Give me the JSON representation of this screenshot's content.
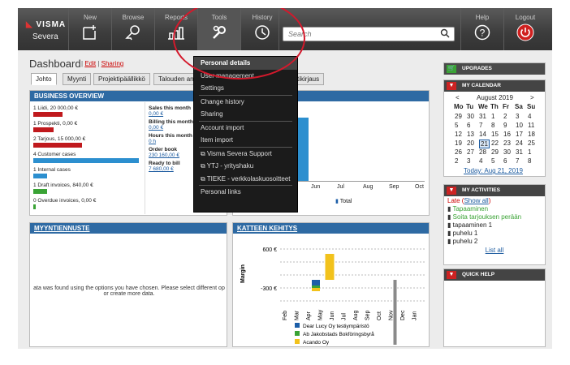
{
  "brand": {
    "logo": "VISMA",
    "product": "Severa"
  },
  "nav": [
    {
      "id": "new",
      "label": "New"
    },
    {
      "id": "browse",
      "label": "Browse"
    },
    {
      "id": "reports",
      "label": "Reports"
    },
    {
      "id": "tools",
      "label": "Tools"
    },
    {
      "id": "history",
      "label": "History"
    },
    {
      "id": "help",
      "label": "Help"
    },
    {
      "id": "logout",
      "label": "Logout"
    }
  ],
  "search": {
    "placeholder": "Search"
  },
  "dashboard": {
    "title": "Dashboard",
    "edit": "Edit",
    "sharing": "Sharing"
  },
  "tabs": [
    "Johto",
    "Myynti",
    "Projektipäällikkö",
    "Talouden an",
    "tikirjaus"
  ],
  "business_overview": {
    "title": "BUSINESS OVERVIEW",
    "rows": [
      {
        "label": "1 Liidi, 20 000,00 €",
        "color": "#c0191d",
        "fill": 0.27
      },
      {
        "label": "1 Prospekti, 0,00 €",
        "color": "#c0191d",
        "fill": 0.19
      },
      {
        "label": "2 Tarjous, 15 000,00 €",
        "color": "#c0191d",
        "fill": 0.45
      },
      {
        "label": "4 Customer cases",
        "color": "#2c8fcf",
        "fill": 0.97
      },
      {
        "label": "1 Internal cases",
        "color": "#2c8fcf",
        "fill": 0.13
      },
      {
        "label": "1 Draft invoices, 840,00 €",
        "color": "#3aa335",
        "fill": 0.13
      },
      {
        "label": "0 Overdue invoices, 0,00 €",
        "color": "#3aa335",
        "fill": 0.02
      }
    ],
    "stats": [
      {
        "label": "Sales this month",
        "value": "0,00 €"
      },
      {
        "label": "Billing this month",
        "value": "0,00 €"
      },
      {
        "label": "Hours this month",
        "value": "0 h"
      },
      {
        "label": "Order book",
        "value": "230 160,00 €"
      },
      {
        "label": "Ready to bill",
        "value": "7 680,00 €"
      }
    ]
  },
  "billing_chart": {
    "months": [
      "Jun",
      "Jul",
      "Aug",
      "Sep",
      "Oct"
    ],
    "legend": "Total"
  },
  "myyntiennuste": {
    "title": "MYYNTIENNUSTE",
    "message1": "ata was found using the options you have chosen. Please select different op",
    "message2": "or create more data."
  },
  "kate": {
    "title": "KATTEEN KEHITYS",
    "ylabel": "Margin",
    "yticks": [
      "600 €",
      "-300 €"
    ],
    "months": [
      "Feb",
      "Mar",
      "Apr",
      "May",
      "Jun",
      "Jul",
      "Aug",
      "Sep",
      "Oct",
      "Nov",
      "Dec",
      "Jan"
    ],
    "legend": [
      "Dear Lucy Oy testiympäristö",
      "Ab Jakobstads Bokföringsbyrå",
      "Acando Oy"
    ],
    "colors": [
      "#1c5ea8",
      "#3aa335",
      "#f2c21c",
      "#8a8a8a"
    ]
  },
  "tools_menu": [
    {
      "label": "Personal details",
      "highlight": true
    },
    {
      "label": "User management"
    },
    {
      "label": "Settings"
    },
    {
      "sep": true
    },
    {
      "label": "Change history"
    },
    {
      "label": "Sharing"
    },
    {
      "sep": true
    },
    {
      "label": "Account import"
    },
    {
      "label": "Item import"
    },
    {
      "sep": true
    },
    {
      "label": "Visma Severa Support",
      "ext": true
    },
    {
      "label": "YTJ - yrityshaku",
      "ext": true
    },
    {
      "label": "TIEKE - verkkolaskuosoitteet",
      "ext": true
    },
    {
      "sep": true
    },
    {
      "label": "Personal links"
    }
  ],
  "upgrades": {
    "title": "UPGRADES"
  },
  "calendar": {
    "title": "MY CALENDAR",
    "month": "August 2019",
    "prev": "<",
    "next": ">",
    "weekdays": [
      "Mo",
      "Tu",
      "We",
      "Th",
      "Fr",
      "Sa",
      "Su"
    ],
    "weeks": [
      [
        "29",
        "30",
        "31",
        "1",
        "2",
        "3",
        "4"
      ],
      [
        "5",
        "6",
        "7",
        "8",
        "9",
        "10",
        "11"
      ],
      [
        "12",
        "13",
        "14",
        "15",
        "16",
        "17",
        "18"
      ],
      [
        "19",
        "20",
        "21",
        "22",
        "23",
        "24",
        "25"
      ],
      [
        "26",
        "27",
        "28",
        "29",
        "30",
        "31",
        "1"
      ],
      [
        "2",
        "3",
        "4",
        "5",
        "6",
        "7",
        "8"
      ]
    ],
    "today": "Today: Aug 21, 2019"
  },
  "activities": {
    "title": "MY ACTIVITIES",
    "late": "Late",
    "show_all": "Show all",
    "items": [
      {
        "label": "Tapaaminen",
        "color": "#3aa335"
      },
      {
        "label": "Soita tarjouksen perään",
        "color": "#3aa335"
      },
      {
        "label": "tapaaminen 1",
        "color": "#222"
      },
      {
        "label": "puhelu 1",
        "color": "#222"
      },
      {
        "label": "puhelu 2",
        "color": "#222"
      }
    ],
    "list_all": "List all"
  },
  "quick_help": {
    "title": "QUICK HELP"
  }
}
